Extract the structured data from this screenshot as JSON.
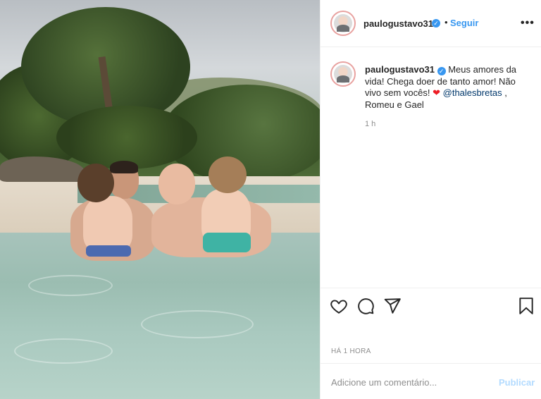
{
  "post": {
    "username": "paulogustavo31",
    "verified_mark": "✓",
    "separator": "•",
    "follow_label": "Seguir",
    "more_label": "•••",
    "caption_text_1": "Meus amores da vida! Chega doer de tanto amor! Não vivo sem vocês!",
    "caption_heart": "❤",
    "caption_mention": "@thalesbretas",
    "caption_text_2": ", Romeu e Gael",
    "comment_time": "1 h",
    "posted_ago": "HÁ 1 HORA",
    "comment_placeholder": "Adicione um comentário...",
    "publish_label": "Publicar"
  },
  "icons": [
    "heart-icon",
    "comment-icon",
    "share-icon",
    "bookmark-icon",
    "verified-icon"
  ],
  "colors": {
    "accent": "#3897f0",
    "mention": "#00376b",
    "heart": "#ed1c24",
    "muted": "#8e8e8e",
    "publish_disabled": "#b3dbff"
  }
}
